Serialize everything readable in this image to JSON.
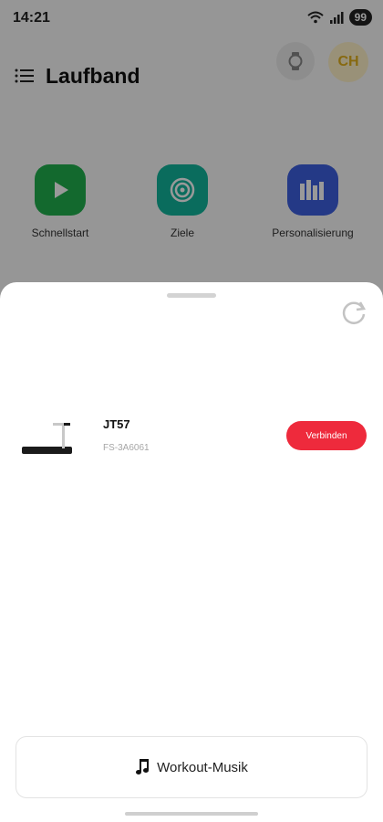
{
  "status_bar": {
    "time": "14:21",
    "battery": "99"
  },
  "header": {
    "title": "Laufband",
    "avatar_initials": "CH"
  },
  "shortcuts": [
    {
      "label": "Schnellstart",
      "color": "#21b04e",
      "icon": "play-icon"
    },
    {
      "label": "Ziele",
      "color": "#12b59c",
      "icon": "target-icon"
    },
    {
      "label": "Personalisierung",
      "color": "#3d5fe0",
      "icon": "equalizer-icon"
    }
  ],
  "sheet": {
    "device": {
      "name": "JT57",
      "id": "FS-3A6061",
      "connect_label": "Verbinden"
    },
    "music_label": "Workout-Musik"
  },
  "colors": {
    "accent": "#ee2a3c",
    "overlay": "rgba(0,0,0,0.40)"
  }
}
